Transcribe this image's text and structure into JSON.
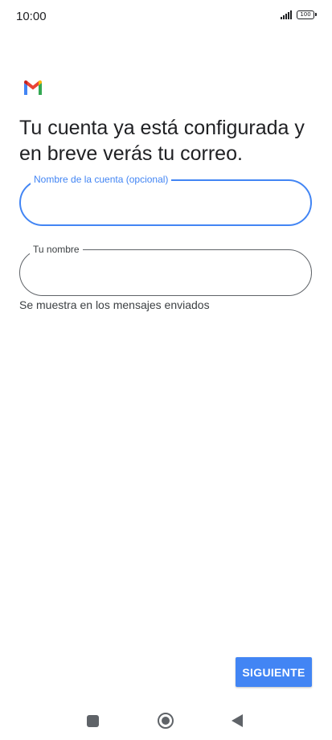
{
  "status_bar": {
    "time": "10:00",
    "battery": "100"
  },
  "heading": "Tu cuenta ya está configurada y en breve verás tu correo.",
  "fields": {
    "account_name": {
      "label": "Nombre de la cuenta (opcional)",
      "value": ""
    },
    "your_name": {
      "label": "Tu nombre",
      "value": ""
    }
  },
  "helper_text": "Se muestra en los mensajes enviados",
  "next_button": {
    "label": "SIGUIENTE"
  },
  "colors": {
    "accent": "#4285f4",
    "gmail_red": "#ea4335",
    "gmail_blue": "#4285f4",
    "gmail_green": "#34a853",
    "gmail_yellow": "#fbbc05"
  },
  "icons": {
    "logo": "gmail-logo-icon",
    "signal": "signal-icon",
    "battery": "battery-icon",
    "nav_recent": "recent-apps-icon",
    "nav_home": "home-icon",
    "nav_back": "back-icon"
  }
}
